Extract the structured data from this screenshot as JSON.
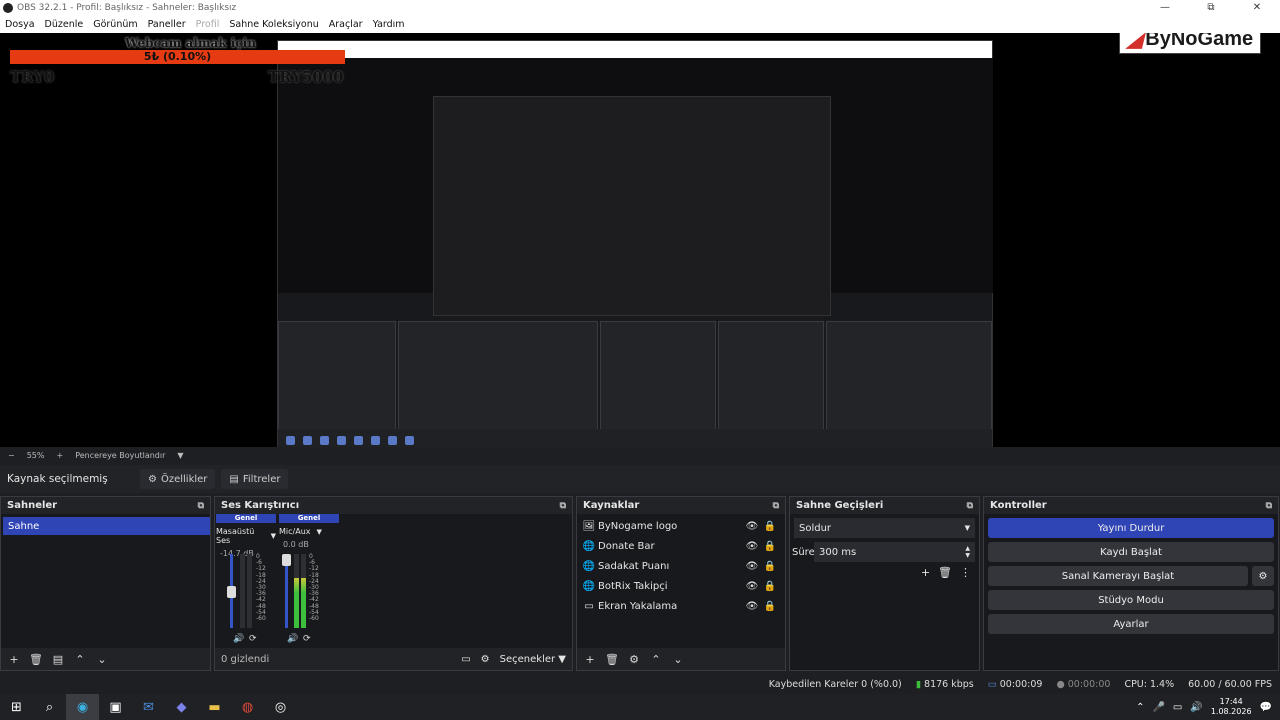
{
  "window": {
    "title": "OBS 32.2.1 - Profil: Başlıksız - Sahneler: Başlıksız",
    "min_icon": "—",
    "max_icon": "⧉",
    "close_icon": "✕"
  },
  "menu": {
    "items": [
      "Dosya",
      "Düzenle",
      "Görünüm",
      "Paneller",
      "Profil",
      "Sahne Koleksiyonu",
      "Araçlar",
      "Yardım"
    ]
  },
  "preview": {
    "logo": "ByNoGame",
    "donate_title": "Webcam almak için",
    "donate_bar": "5₺ (0.10%)",
    "current_amount": "TRY0",
    "goal_amount": "TRY5000"
  },
  "zoom": {
    "minus": "−",
    "value": "55%",
    "plus": "+",
    "mode": "Pencereye Boyutlandır"
  },
  "source_bar": {
    "label": "Kaynak seçilmemiş",
    "properties": "Özellikler",
    "filters": "Filtreler"
  },
  "docks": {
    "scenes": {
      "title": "Sahneler",
      "items": [
        "Sahne"
      ]
    },
    "mixer": {
      "title": "Ses Karıştırıcı",
      "channels": [
        {
          "tag": "Genel",
          "name": "Masaüstü Ses",
          "db": "-14.7 dB",
          "level": 0.55
        },
        {
          "tag": "Genel",
          "name": "Mic/Aux",
          "db": "0.0 dB",
          "level": 0.68
        }
      ],
      "ticks": [
        "0",
        "-6",
        "-12",
        "-18",
        "-24",
        "-30",
        "-36",
        "-42",
        "-48",
        "-54",
        "-60"
      ],
      "hidden": "0 gizlendi",
      "options": "Seçenekler"
    },
    "sources": {
      "title": "Kaynaklar",
      "items": [
        {
          "name": "ByNogame logo",
          "icon": "image-icon"
        },
        {
          "name": "Donate Bar",
          "icon": "globe-icon"
        },
        {
          "name": "Sadakat Puanı",
          "icon": "globe-icon"
        },
        {
          "name": "BotRix Takipçi",
          "icon": "globe-icon"
        },
        {
          "name": "Ekran Yakalama",
          "icon": "monitor-icon"
        }
      ]
    },
    "transitions": {
      "title": "Sahne Geçişleri",
      "selected": "Soldur",
      "duration_label": "Süre",
      "duration": "300 ms"
    },
    "controls": {
      "title": "Kontroller",
      "stream": "Yayını Durdur",
      "record": "Kaydı Başlat",
      "virtualcam": "Sanal Kamerayı Başlat",
      "studio": "Stüdyo Modu",
      "settings": "Ayarlar"
    }
  },
  "status": {
    "dropped": "Kaybedilen Kareler 0 (%0.0)",
    "bitrate": "8176 kbps",
    "stream_time": "00:00:09",
    "rec_time": "00:00:00",
    "cpu": "CPU: 1.4%",
    "fps": "60.00 / 60.00 FPS"
  },
  "taskbar": {
    "time": "17:44",
    "date": "1.08.2026"
  },
  "colors": {
    "accent": "#2f44b5",
    "donate": "#e63a12",
    "logo_red": "#d3302b"
  }
}
